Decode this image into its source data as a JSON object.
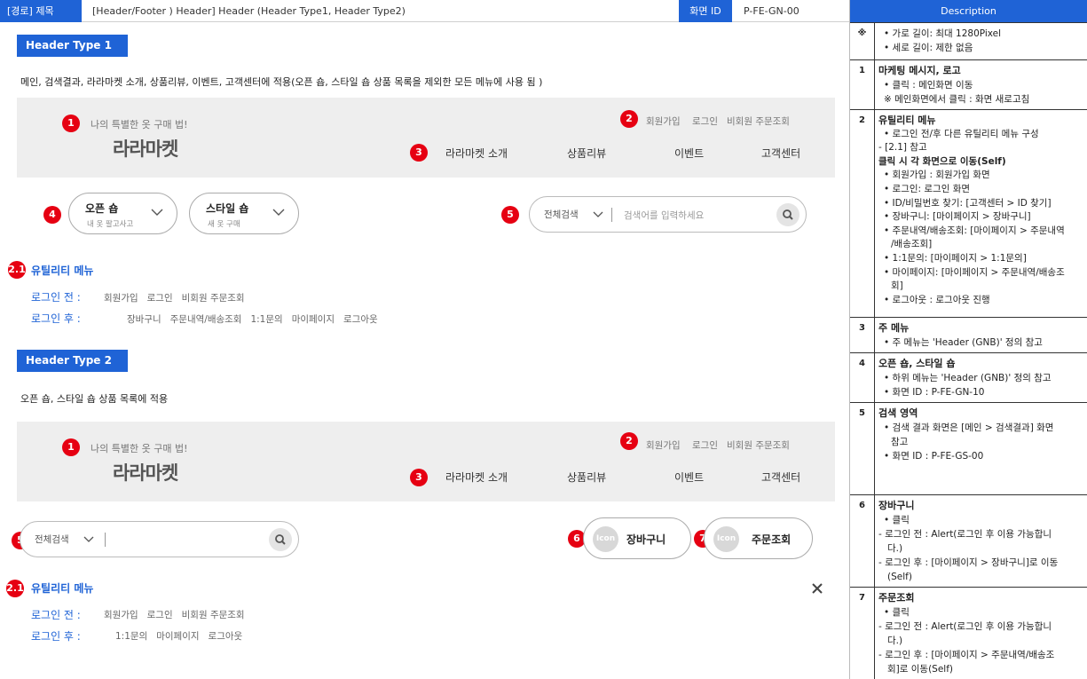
{
  "topbar": {
    "path_label": "[경로] 제목",
    "title": "[Header/Footer ) Header] Header (Header Type1, Header Type2)",
    "id_label": "화면 ID",
    "id_value": "P-FE-GN-00"
  },
  "type1": {
    "label": "Header Type 1",
    "desc": "메인, 검색결과, 라라마켓 소개, 상품리뷰, 이벤트, 고객센터에 적용(오픈 숍, 스타일 숍 상품 목록을 제외한 모든 메뉴에 사용 됨 )",
    "header": {
      "slogan": "나의 특별한 옷 구매 법!",
      "logo": "라라마켓",
      "util": [
        "회원가입",
        "로그인",
        "비회원 주문조회"
      ],
      "gnb": [
        "라라마켓 소개",
        "상품리뷰",
        "이벤트",
        "고객센터"
      ]
    },
    "open_shop": {
      "title": "오픈 숍",
      "sub": "내 옷 팔고사고"
    },
    "style_shop": {
      "title": "스타일 숍",
      "sub": "새 옷 구매"
    },
    "search": {
      "category": "전체검색",
      "placeholder": "검색어를 입력하세요"
    },
    "utility": {
      "title": "유틸리티 메뉴",
      "before_label": "로그인 전 :",
      "before_items": [
        "회원가입",
        "로그인",
        "비회원 주문조회"
      ],
      "after_label": "로그인 후 :",
      "after_items": [
        "장바구니",
        "주문내역/배송조회",
        "1:1문의",
        "마이페이지",
        "로그아웃"
      ]
    }
  },
  "type2": {
    "label": "Header Type 2",
    "desc": "오픈 숍, 스타일 숍 상품 목록에 적용",
    "header": {
      "slogan": "나의 특별한 옷 구매 법!",
      "logo": "라라마켓",
      "util": [
        "회원가입",
        "로그인",
        "비회원 주문조회"
      ],
      "gnb": [
        "라라마켓 소개",
        "상품리뷰",
        "이벤트",
        "고객센터"
      ]
    },
    "search": {
      "category": "전체검색"
    },
    "cart": {
      "icon": "Icon",
      "label": "장바구니"
    },
    "order": {
      "icon": "Icon",
      "label": "주문조회"
    },
    "utility": {
      "title": "유틸리티 메뉴",
      "before_label": "로그인 전 :",
      "before_items": [
        "회원가입",
        "로그인",
        "비회원 주문조회"
      ],
      "after_label": "로그인 후 :",
      "after_items": [
        "1:1문의",
        "마이페이지",
        "로그아웃"
      ]
    }
  },
  "badges": {
    "b1": "1",
    "b2": "2",
    "b3": "3",
    "b4": "4",
    "b5": "5",
    "b6": "6",
    "b7": "7",
    "b21": "2.1"
  },
  "description": {
    "head": "Description",
    "rows": [
      {
        "num": "※",
        "lines": [
          "• 가로 길이: 최대 1280Pixel",
          "• 세로 길이: 제한 없음"
        ]
      },
      {
        "num": "1",
        "title": "마케팅 메시지, 로고",
        "lines": [
          "• 클릭 : 메인화면 이동",
          "※ 메인화면에서 클릭 : 화면 새로고침"
        ]
      },
      {
        "num": "2",
        "title": "유틸리티 메뉴",
        "lines": [
          "• 로그인 전/후 다른 유틸리티 메뉴 구성",
          "- [2.1] 참고",
          "클릭 시 각 화면으로 이동(Self)",
          "• 회원가입 : 회원가입 화면",
          "• 로그인: 로그인 화면",
          "• ID/비밀번호 찾기: [고객센터 > ID 찾기]",
          "• 장바구니: [마이페이지 > 장바구니]",
          "• 주문내역/배송조회: [마이페이지 > 주문내역",
          "/배송조회]",
          "• 1:1문의: [마이페이지 > 1:1문의]",
          "• 마이페이지: [마이페이지 > 주문내역/배송조",
          "회]",
          "• 로그아웃 : 로그아웃 진행"
        ]
      },
      {
        "num": "3",
        "title": "주 메뉴",
        "lines": [
          "• 주 메뉴는 'Header (GNB)' 정의 참고"
        ]
      },
      {
        "num": "4",
        "title": "오픈 숍, 스타일 숍",
        "lines": [
          "• 하위 메뉴는 'Header (GNB)' 정의 참고",
          "• 화면 ID : P-FE-GN-10"
        ]
      },
      {
        "num": "5",
        "title": "검색 영역",
        "lines": [
          "• 검색 결과 화면은 [메인 > 검색결과] 화면",
          "참고",
          "• 화면 ID : P-FE-GS-00"
        ]
      },
      {
        "num": "6",
        "title": "장바구니",
        "lines": [
          "• 클릭",
          "- 로그인 전 : Alert(로그인 후 이용 가능합니",
          "다.)",
          "- 로그인 후 : [마이페이지 > 장바구니]로 이동",
          "(Self)"
        ]
      },
      {
        "num": "7",
        "title": "주문조회",
        "lines": [
          "• 클릭",
          "- 로그인 전 : Alert(로그인 후 이용 가능합니",
          "다.)",
          "- 로그인 후 : [마이페이지 > 주문내역/배송조",
          "회]로 이동(Self)"
        ]
      }
    ]
  }
}
